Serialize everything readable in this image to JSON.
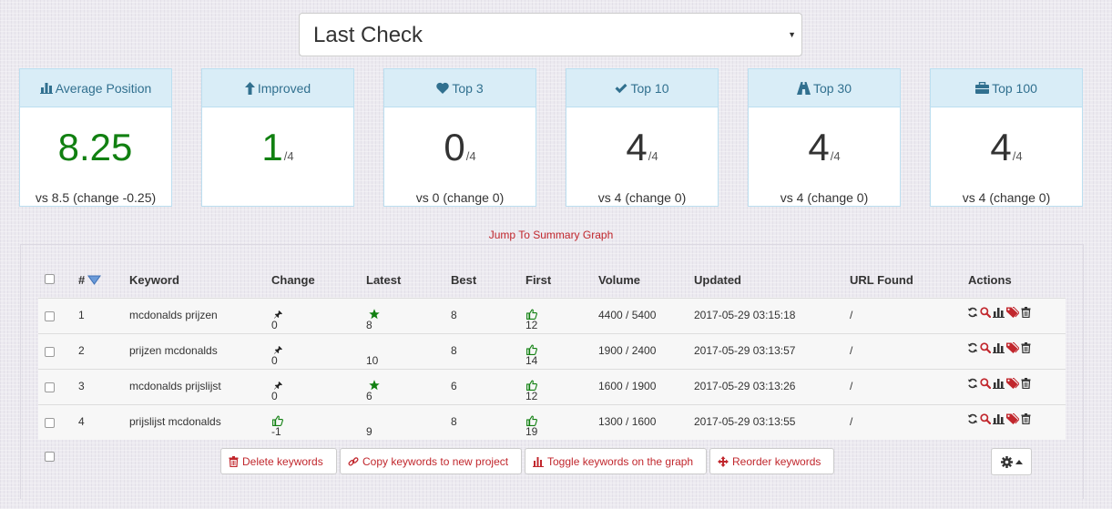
{
  "period_select": {
    "value": "Last Check"
  },
  "stats": [
    {
      "icon": "bar-chart-icon",
      "label": "Average Position",
      "value": "8.25",
      "of": "",
      "sub": "vs 8.5 (change -0.25)"
    },
    {
      "icon": "arrow-up-icon",
      "label": "Improved",
      "value": "1",
      "of": "/4",
      "sub": ""
    },
    {
      "icon": "heart-icon",
      "label": "Top 3",
      "value": "0",
      "of": "/4",
      "sub": "vs 0 (change 0)"
    },
    {
      "icon": "check-icon",
      "label": "Top 10",
      "value": "4",
      "of": "/4",
      "sub": "vs 4 (change 0)"
    },
    {
      "icon": "road-icon",
      "label": "Top 30",
      "value": "4",
      "of": "/4",
      "sub": "vs 4 (change 0)"
    },
    {
      "icon": "briefcase-icon",
      "label": "Top 100",
      "value": "4",
      "of": "/4",
      "sub": "vs 4 (change 0)"
    }
  ],
  "jump_link": "Jump To Summary Graph",
  "table": {
    "headers": {
      "num": "#",
      "keyword": "Keyword",
      "change": "Change",
      "latest": "Latest",
      "best": "Best",
      "first": "First",
      "volume": "Volume",
      "updated": "Updated",
      "url": "URL Found",
      "actions": "Actions"
    },
    "rows": [
      {
        "num": "1",
        "keyword": "mcdonalds prijzen",
        "change": "0",
        "change_icon": "pin-icon",
        "latest": "8",
        "latest_star": true,
        "best": "8",
        "first": "12",
        "volume": "4400 / 5400",
        "updated": "2017-05-29 03:15:18",
        "url": "/"
      },
      {
        "num": "2",
        "keyword": "prijzen mcdonalds",
        "change": "0",
        "change_icon": "pin-icon",
        "latest": "10",
        "latest_star": false,
        "best": "8",
        "first": "14",
        "volume": "1900 / 2400",
        "updated": "2017-05-29 03:13:57",
        "url": "/"
      },
      {
        "num": "3",
        "keyword": "mcdonalds prijslijst",
        "change": "0",
        "change_icon": "pin-icon",
        "latest": "6",
        "latest_star": true,
        "best": "6",
        "first": "12",
        "volume": "1600 / 1900",
        "updated": "2017-05-29 03:13:26",
        "url": "/"
      },
      {
        "num": "4",
        "keyword": "prijslijst mcdonalds",
        "change": "-1",
        "change_icon": "thumbs-up-icon",
        "latest": "9",
        "latest_star": false,
        "best": "8",
        "first": "19",
        "volume": "1300 / 1600",
        "updated": "2017-05-29 03:13:55",
        "url": "/"
      }
    ]
  },
  "buttons": {
    "delete": "Delete keywords",
    "copy": "Copy keywords to new project",
    "toggle": "Toggle keywords on the graph",
    "reorder": "Reorder keywords"
  },
  "colors": {
    "accent": "#c1272d",
    "green": "#118011",
    "head_bg": "#d9edf7",
    "head_text": "#31708f"
  }
}
